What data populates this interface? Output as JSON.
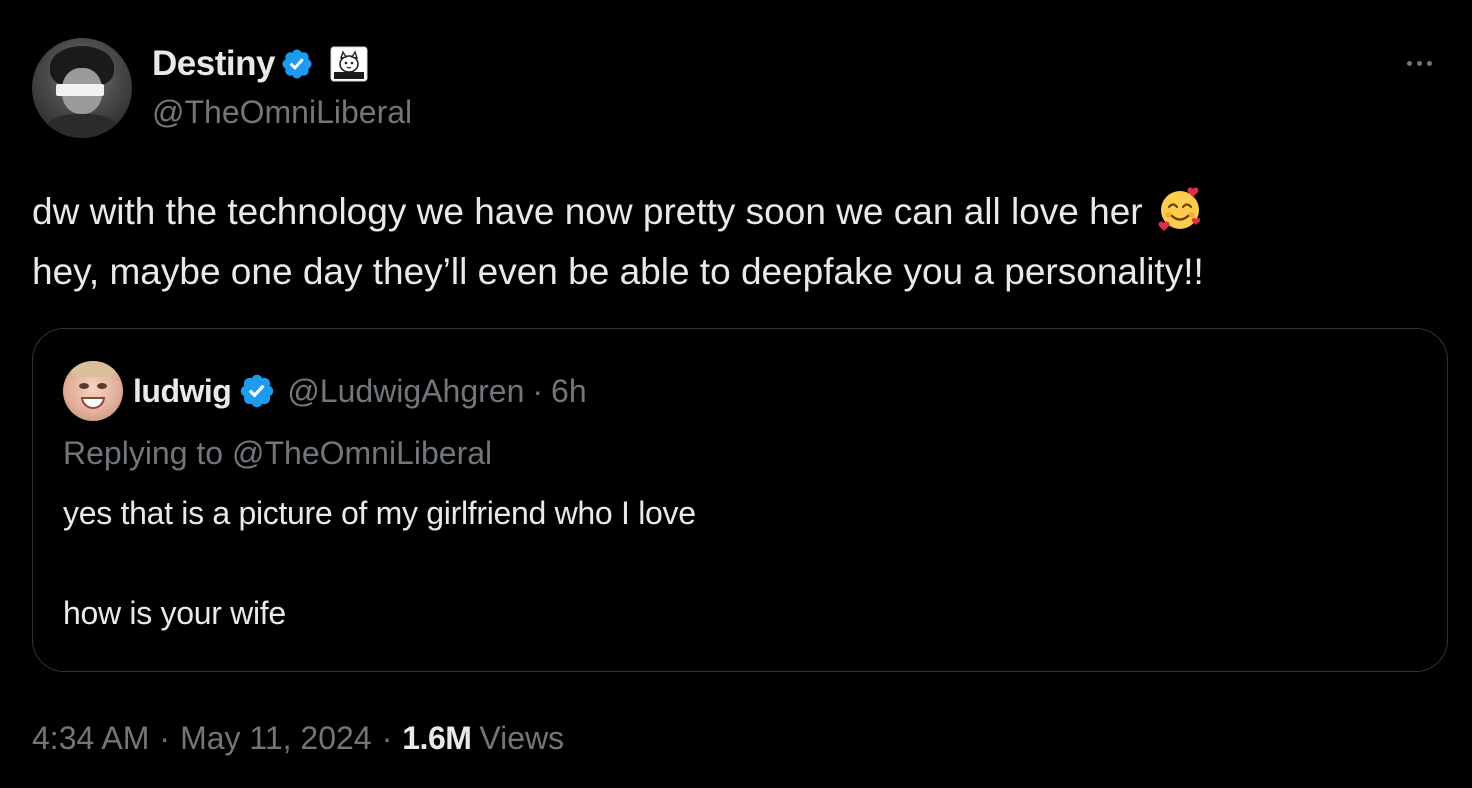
{
  "author": {
    "display_name": "Destiny",
    "handle": "@TheOmniLiberal"
  },
  "tweet": {
    "line1": "dw with the technology we have now pretty soon we can all love her",
    "line2": "hey, maybe one day they’ll even be able to deepfake you a personality!!",
    "emoji": "smiling-face-with-hearts"
  },
  "quoted": {
    "display_name": "ludwig",
    "handle": "@LudwigAhgren",
    "separator": "·",
    "time": "6h",
    "replying_prefix": "Replying to",
    "replying_handle": "@TheOmniLiberal",
    "text_line1": "yes that is a picture of my girlfriend who I love",
    "text_line2": "how is your wife"
  },
  "meta": {
    "time": "4:34 AM",
    "separator": "·",
    "date": "May 11, 2024",
    "views_count": "1.6M",
    "views_label": "Views"
  },
  "colors": {
    "background": "#000000",
    "text_primary": "#e7e9ea",
    "text_secondary": "#71767b",
    "verified_blue": "#1d9bf0",
    "border": "#2f3336"
  }
}
